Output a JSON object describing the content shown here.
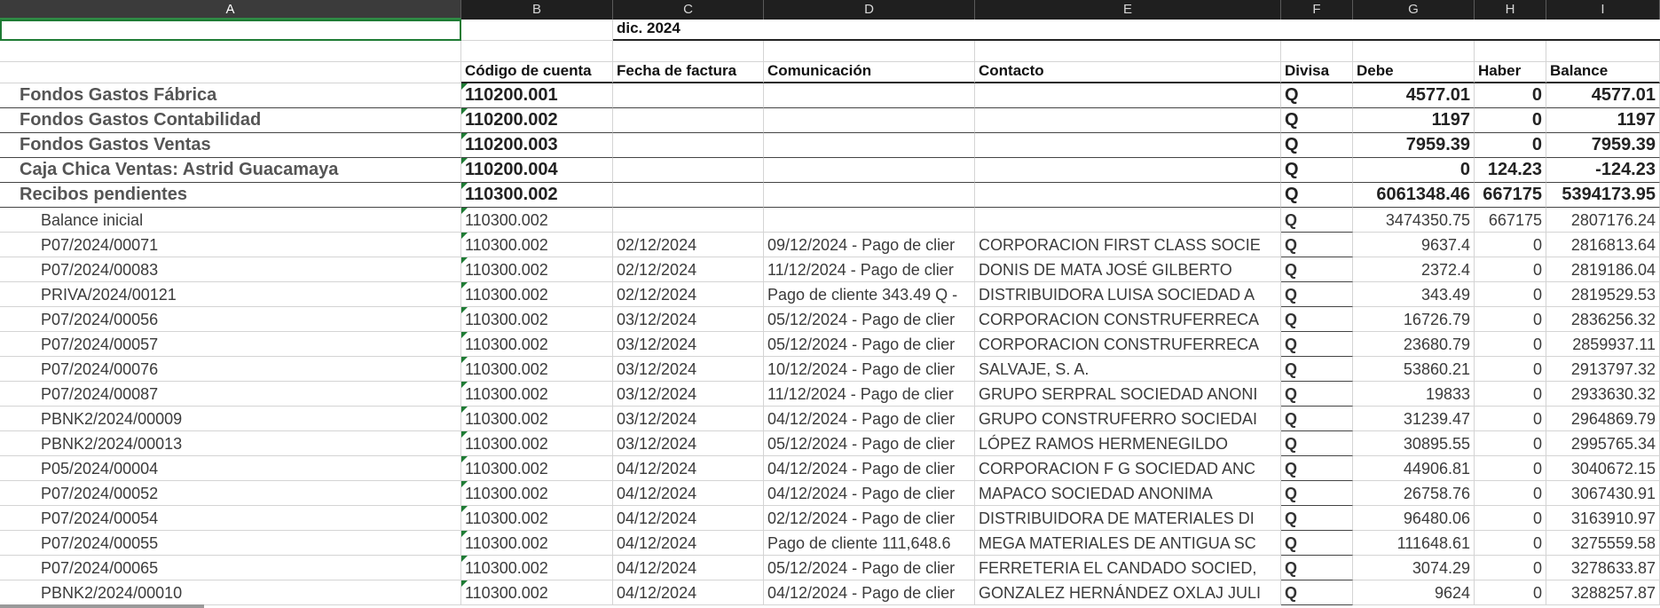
{
  "columns": [
    "A",
    "B",
    "C",
    "D",
    "E",
    "F",
    "G",
    "H",
    "I"
  ],
  "title_row": {
    "month": "dic. 2024"
  },
  "headers": {
    "account_code": "Código de cuenta",
    "invoice_date": "Fecha de factura",
    "communication": "Comunicación",
    "contact": "Contacto",
    "currency": "Divisa",
    "debit": "Debe",
    "credit": "Haber",
    "balance": "Balance"
  },
  "groups": [
    {
      "name": "Fondos Gastos Fábrica",
      "code": "110200.001",
      "currency": "Q",
      "debit": "4577.01",
      "credit": "0",
      "balance": "4577.01"
    },
    {
      "name": "Fondos Gastos Contabilidad",
      "code": "110200.002",
      "currency": "Q",
      "debit": "1197",
      "credit": "0",
      "balance": "1197"
    },
    {
      "name": "Fondos Gastos Ventas",
      "code": "110200.003",
      "currency": "Q",
      "debit": "7959.39",
      "credit": "0",
      "balance": "7959.39"
    },
    {
      "name": "Caja Chica Ventas: Astrid Guacamaya",
      "code": "110200.004",
      "currency": "Q",
      "debit": "0",
      "credit": "124.23",
      "balance": "-124.23"
    },
    {
      "name": "Recibos pendientes",
      "code": "110300.002",
      "currency": "Q",
      "debit": "6061348.46",
      "credit": "667175",
      "balance": "5394173.95"
    }
  ],
  "details": [
    {
      "ref": "Balance inicial",
      "code": "110300.002",
      "date": "",
      "comm": "",
      "contact": "",
      "currency": "Q",
      "debit": "3474350.75",
      "credit": "667175",
      "balance": "2807176.24"
    },
    {
      "ref": "P07/2024/00071",
      "code": "110300.002",
      "date": "02/12/2024",
      "comm": "09/12/2024 - Pago de clier",
      "contact": "CORPORACION FIRST CLASS SOCIE",
      "currency": "Q",
      "debit": "9637.4",
      "credit": "0",
      "balance": "2816813.64"
    },
    {
      "ref": "P07/2024/00083",
      "code": "110300.002",
      "date": "02/12/2024",
      "comm": "11/12/2024 - Pago de clier",
      "contact": "DONIS DE MATA JOSÉ GILBERTO",
      "currency": "Q",
      "debit": "2372.4",
      "credit": "0",
      "balance": "2819186.04"
    },
    {
      "ref": "PRIVA/2024/00121",
      "code": "110300.002",
      "date": "02/12/2024",
      "comm": "Pago de cliente 343.49 Q -",
      "contact": "DISTRIBUIDORA LUISA SOCIEDAD A",
      "currency": "Q",
      "debit": "343.49",
      "credit": "0",
      "balance": "2819529.53"
    },
    {
      "ref": "P07/2024/00056",
      "code": "110300.002",
      "date": "03/12/2024",
      "comm": "05/12/2024 - Pago de clier",
      "contact": "CORPORACION CONSTRUFERRECA",
      "currency": "Q",
      "debit": "16726.79",
      "credit": "0",
      "balance": "2836256.32"
    },
    {
      "ref": "P07/2024/00057",
      "code": "110300.002",
      "date": "03/12/2024",
      "comm": "05/12/2024 - Pago de clier",
      "contact": "CORPORACION CONSTRUFERRECA",
      "currency": "Q",
      "debit": "23680.79",
      "credit": "0",
      "balance": "2859937.11"
    },
    {
      "ref": "P07/2024/00076",
      "code": "110300.002",
      "date": "03/12/2024",
      "comm": "10/12/2024 - Pago de clier",
      "contact": "SALVAJE, S. A.",
      "currency": "Q",
      "debit": "53860.21",
      "credit": "0",
      "balance": "2913797.32"
    },
    {
      "ref": "P07/2024/00087",
      "code": "110300.002",
      "date": "03/12/2024",
      "comm": "11/12/2024 - Pago de clier",
      "contact": "GRUPO SERPRAL SOCIEDAD ANONI",
      "currency": "Q",
      "debit": "19833",
      "credit": "0",
      "balance": "2933630.32"
    },
    {
      "ref": "PBNK2/2024/00009",
      "code": "110300.002",
      "date": "03/12/2024",
      "comm": "04/12/2024 - Pago de clier",
      "contact": "GRUPO CONSTRUFERRO SOCIEDAI",
      "currency": "Q",
      "debit": "31239.47",
      "credit": "0",
      "balance": "2964869.79"
    },
    {
      "ref": "PBNK2/2024/00013",
      "code": "110300.002",
      "date": "03/12/2024",
      "comm": "05/12/2024 - Pago de clier",
      "contact": "LÓPEZ RAMOS  HERMENEGILDO",
      "currency": "Q",
      "debit": "30895.55",
      "credit": "0",
      "balance": "2995765.34"
    },
    {
      "ref": "P05/2024/00004",
      "code": "110300.002",
      "date": "04/12/2024",
      "comm": "04/12/2024 - Pago de clier",
      "contact": "CORPORACION F G SOCIEDAD ANC",
      "currency": "Q",
      "debit": "44906.81",
      "credit": "0",
      "balance": "3040672.15"
    },
    {
      "ref": "P07/2024/00052",
      "code": "110300.002",
      "date": "04/12/2024",
      "comm": "04/12/2024 - Pago de clier",
      "contact": "MAPACO SOCIEDAD ANONIMA",
      "currency": "Q",
      "debit": "26758.76",
      "credit": "0",
      "balance": "3067430.91"
    },
    {
      "ref": "P07/2024/00054",
      "code": "110300.002",
      "date": "04/12/2024",
      "comm": "02/12/2024 - Pago de clier",
      "contact": "DISTRIBUIDORA DE MATERIALES DI",
      "currency": "Q",
      "debit": "96480.06",
      "credit": "0",
      "balance": "3163910.97"
    },
    {
      "ref": "P07/2024/00055",
      "code": "110300.002",
      "date": "04/12/2024",
      "comm": "Pago de cliente 111,648.6",
      "contact": "MEGA MATERIALES DE ANTIGUA SC",
      "currency": "Q",
      "debit": "111648.61",
      "credit": "0",
      "balance": "3275559.58"
    },
    {
      "ref": "P07/2024/00065",
      "code": "110300.002",
      "date": "04/12/2024",
      "comm": "05/12/2024 - Pago de clier",
      "contact": "FERRETERIA EL CANDADO SOCIED,",
      "currency": "Q",
      "debit": "3074.29",
      "credit": "0",
      "balance": "3278633.87"
    },
    {
      "ref": "PBNK2/2024/00010",
      "code": "110300.002",
      "date": "04/12/2024",
      "comm": "04/12/2024 - Pago de clier",
      "contact": "GONZALEZ HERNÁNDEZ OXLAJ JULI",
      "currency": "Q",
      "debit": "9624",
      "credit": "0",
      "balance": "3288257.87"
    }
  ]
}
